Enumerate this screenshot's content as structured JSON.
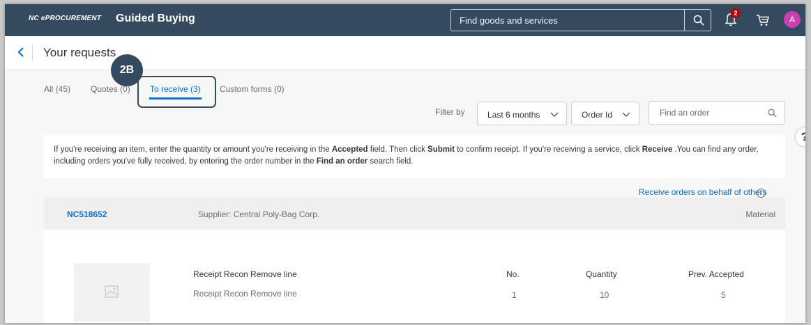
{
  "header": {
    "brand": "NC ePROCUREMENT",
    "title": "Guided Buying",
    "search_placeholder": "Find goods and services",
    "notification_count": "2",
    "avatar_initial": "A"
  },
  "page": {
    "title": "Your requests"
  },
  "tabs": [
    {
      "label": "All (45)"
    },
    {
      "label": "Quotes (0)"
    },
    {
      "label": "To receive (3)"
    },
    {
      "label": "Custom forms (0)"
    }
  ],
  "callout": {
    "label": "2B"
  },
  "filters": {
    "label": "Filter by",
    "period": "Last 6 months",
    "field": "Order Id",
    "find_placeholder": "Find an order"
  },
  "help": {
    "label": "?"
  },
  "info": {
    "part1": "If you're receiving an item, enter the quantity or amount you're receiving in the ",
    "accepted": "Accepted",
    "part2": " field. Then click ",
    "submit": "Submit",
    "part3": " to confirm receipt. If you're receiving a service, click ",
    "receive": "Receive",
    "part4": " .You can find any order, including orders you've fully received, by entering the order number in the ",
    "find_an_order": "Find an order",
    "part5": " search field."
  },
  "behalf_link": "Receive orders on behalf of others",
  "info_icon": "i",
  "order": {
    "id": "NC518652",
    "supplier": "Supplier: Central Poly-Bag Corp.",
    "type": "Material",
    "item_name": "Receipt Recon Remove line",
    "item_desc": "Receipt Recon Remove line",
    "col_no": "No.",
    "col_qty": "Quantity",
    "col_prev": "Prev. Accepted",
    "no": "1",
    "quantity": "10",
    "prev_accepted": "5"
  },
  "colors": {
    "header_bg": "#354a5f",
    "accent": "#0a6ed1",
    "badge": "#bb0000",
    "avatar": "#c73fb0"
  }
}
